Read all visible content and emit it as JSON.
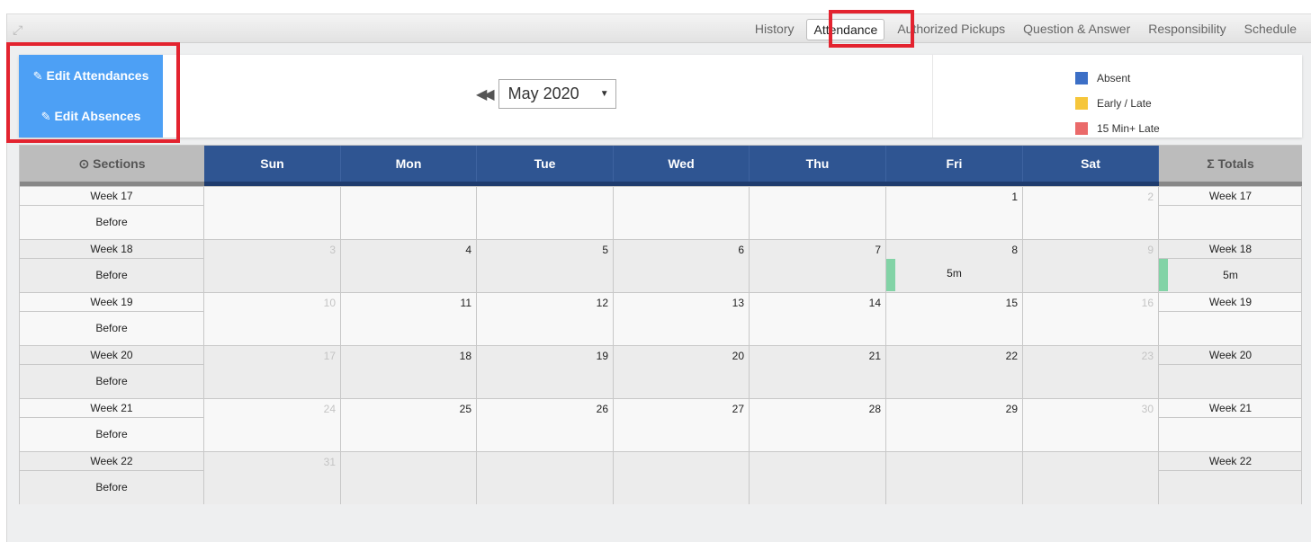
{
  "tabs": [
    {
      "label": "History",
      "active": false
    },
    {
      "label": "Attendance",
      "active": true
    },
    {
      "label": "Authorized Pickups",
      "active": false
    },
    {
      "label": "Question & Answer",
      "active": false
    },
    {
      "label": "Responsibility",
      "active": false
    },
    {
      "label": "Schedule",
      "active": false
    }
  ],
  "edit": {
    "attendances_label": "Edit Attendances",
    "absences_label": "Edit Absences",
    "icon": "edit-icon"
  },
  "month_select": {
    "value": "May 2020"
  },
  "legend": [
    {
      "label": "Absent",
      "color": "#3c6fc6"
    },
    {
      "label": "Early / Late",
      "color": "#f6c63b"
    },
    {
      "label": "15 Min+ Late",
      "color": "#ea6a6a"
    }
  ],
  "calendar": {
    "sections_header": "Sections",
    "totals_header": "Totals",
    "day_headers": [
      "Sun",
      "Mon",
      "Tue",
      "Wed",
      "Thu",
      "Fri",
      "Sat"
    ],
    "weeks": [
      {
        "label": "Week 17",
        "section": "Before",
        "total": "",
        "days": [
          {
            "num": "",
            "muted": false,
            "value": ""
          },
          {
            "num": "",
            "muted": false,
            "value": ""
          },
          {
            "num": "",
            "muted": false,
            "value": ""
          },
          {
            "num": "",
            "muted": false,
            "value": ""
          },
          {
            "num": "",
            "muted": false,
            "value": ""
          },
          {
            "num": "1",
            "muted": false,
            "value": ""
          },
          {
            "num": "2",
            "muted": true,
            "value": ""
          }
        ]
      },
      {
        "label": "Week 18",
        "section": "Before",
        "total": "5m",
        "days": [
          {
            "num": "3",
            "muted": true,
            "value": ""
          },
          {
            "num": "4",
            "muted": false,
            "value": ""
          },
          {
            "num": "5",
            "muted": false,
            "value": ""
          },
          {
            "num": "6",
            "muted": false,
            "value": ""
          },
          {
            "num": "7",
            "muted": false,
            "value": ""
          },
          {
            "num": "8",
            "muted": false,
            "value": "5m"
          },
          {
            "num": "9",
            "muted": true,
            "value": ""
          }
        ]
      },
      {
        "label": "Week 19",
        "section": "Before",
        "total": "",
        "days": [
          {
            "num": "10",
            "muted": true,
            "value": ""
          },
          {
            "num": "11",
            "muted": false,
            "value": ""
          },
          {
            "num": "12",
            "muted": false,
            "value": ""
          },
          {
            "num": "13",
            "muted": false,
            "value": ""
          },
          {
            "num": "14",
            "muted": false,
            "value": ""
          },
          {
            "num": "15",
            "muted": false,
            "value": ""
          },
          {
            "num": "16",
            "muted": true,
            "value": ""
          }
        ]
      },
      {
        "label": "Week 20",
        "section": "Before",
        "total": "",
        "days": [
          {
            "num": "17",
            "muted": true,
            "value": ""
          },
          {
            "num": "18",
            "muted": false,
            "value": ""
          },
          {
            "num": "19",
            "muted": false,
            "value": ""
          },
          {
            "num": "20",
            "muted": false,
            "value": ""
          },
          {
            "num": "21",
            "muted": false,
            "value": ""
          },
          {
            "num": "22",
            "muted": false,
            "value": ""
          },
          {
            "num": "23",
            "muted": true,
            "value": ""
          }
        ]
      },
      {
        "label": "Week 21",
        "section": "Before",
        "total": "",
        "days": [
          {
            "num": "24",
            "muted": true,
            "value": ""
          },
          {
            "num": "25",
            "muted": false,
            "value": ""
          },
          {
            "num": "26",
            "muted": false,
            "value": ""
          },
          {
            "num": "27",
            "muted": false,
            "value": ""
          },
          {
            "num": "28",
            "muted": false,
            "value": ""
          },
          {
            "num": "29",
            "muted": false,
            "value": ""
          },
          {
            "num": "30",
            "muted": true,
            "value": ""
          }
        ]
      },
      {
        "label": "Week 22",
        "section": "Before",
        "total": "",
        "days": [
          {
            "num": "31",
            "muted": true,
            "value": ""
          },
          {
            "num": "",
            "muted": false,
            "value": ""
          },
          {
            "num": "",
            "muted": false,
            "value": ""
          },
          {
            "num": "",
            "muted": false,
            "value": ""
          },
          {
            "num": "",
            "muted": false,
            "value": ""
          },
          {
            "num": "",
            "muted": false,
            "value": ""
          },
          {
            "num": "",
            "muted": false,
            "value": ""
          }
        ]
      }
    ]
  }
}
